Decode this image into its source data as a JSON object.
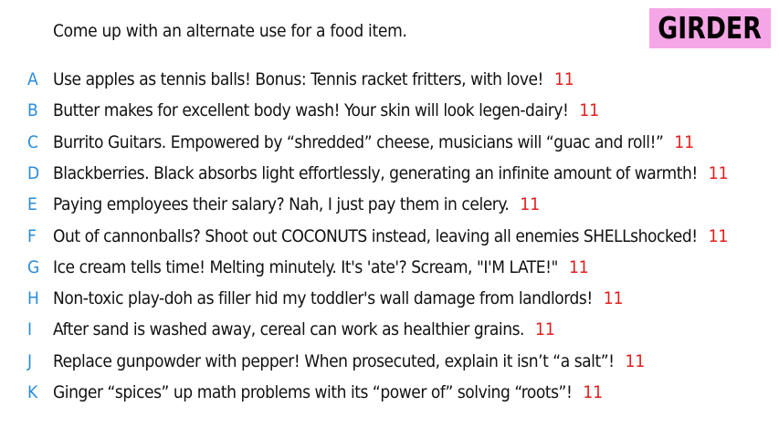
{
  "prompt": "Come up with an alternate use for a food item.",
  "badge": {
    "label": "GIRDER",
    "color": "#f5a6e6"
  },
  "colors": {
    "letter": "#2a8bd8",
    "score": "#e21d1d",
    "text": "#111111"
  },
  "answers": [
    {
      "letter": "A",
      "text": "Use apples as tennis balls! Bonus: Tennis racket fritters, with love!",
      "score": "11"
    },
    {
      "letter": "B",
      "text": "Butter makes for excellent body wash! Your skin will look legen-dairy!",
      "score": "11"
    },
    {
      "letter": "C",
      "text": "Burrito Guitars. Empowered by “shredded” cheese, musicians will “guac and roll!”",
      "score": "11"
    },
    {
      "letter": "D",
      "text": "Blackberries. Black absorbs light effortlessly, generating an infinite amount of warmth!",
      "score": "11"
    },
    {
      "letter": "E",
      "text": "Paying employees their salary? Nah, I just pay them in celery.",
      "score": "11"
    },
    {
      "letter": "F",
      "text": "Out of cannonballs? Shoot out COCONUTS instead, leaving all enemies SHELLshocked!",
      "score": "11"
    },
    {
      "letter": "G",
      "text": "Ice cream tells time! Melting minutely. It's 'ate'? Scream, \"I'M LATE!\"",
      "score": "11"
    },
    {
      "letter": "H",
      "text": "Non-toxic play-doh as filler hid my toddler's wall damage from landlords!",
      "score": "11"
    },
    {
      "letter": "I",
      "text": "After sand is washed away, cereal can work as healthier grains.",
      "score": "11"
    },
    {
      "letter": "J",
      "text": "Replace gunpowder with pepper! When prosecuted, explain it isn’t “a salt”!",
      "score": "11"
    },
    {
      "letter": "K",
      "text": "Ginger “spices” up math problems with its “power of” solving “roots”!",
      "score": "11"
    }
  ]
}
